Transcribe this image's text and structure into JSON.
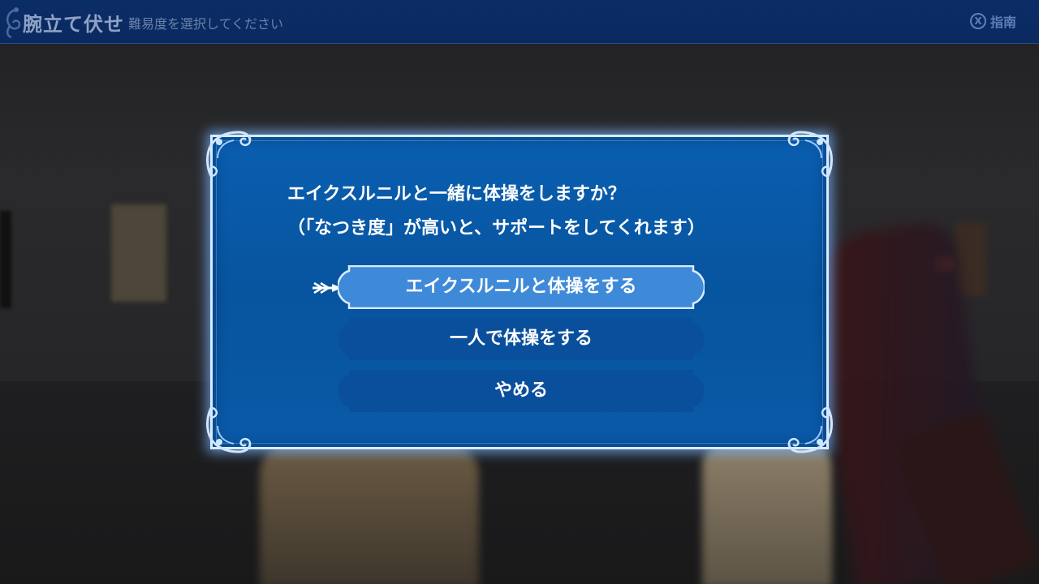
{
  "header": {
    "title": "腕立て伏せ",
    "subtitle": "難易度を選択してください",
    "guide_button_glyph": "X",
    "guide_label": "指南"
  },
  "dialog": {
    "question_line1": "エイクスルニルと一緒に体操をしますか？",
    "question_line2": "（「なつき度」が高いと、サポートをしてくれます）",
    "options": [
      {
        "label": "エイクスルニルと体操をする",
        "selected": true
      },
      {
        "label": "一人で体操をする",
        "selected": false
      },
      {
        "label": "やめる",
        "selected": false
      }
    ]
  },
  "icons": {
    "header_ornament": "fleur-ornament-icon",
    "guide": "x-button-icon",
    "cursor": "arrow-cursor-icon",
    "corner": "scroll-corner-ornament-icon"
  },
  "colors": {
    "header_bg": "#0b2d66",
    "dialog_bg": "#07549f",
    "dialog_border": "#d8ecff",
    "option_selected": "#3f8ad8",
    "option_normal": "#0a4f9c",
    "text": "#ffffff",
    "header_text": "#8fa2c5"
  }
}
